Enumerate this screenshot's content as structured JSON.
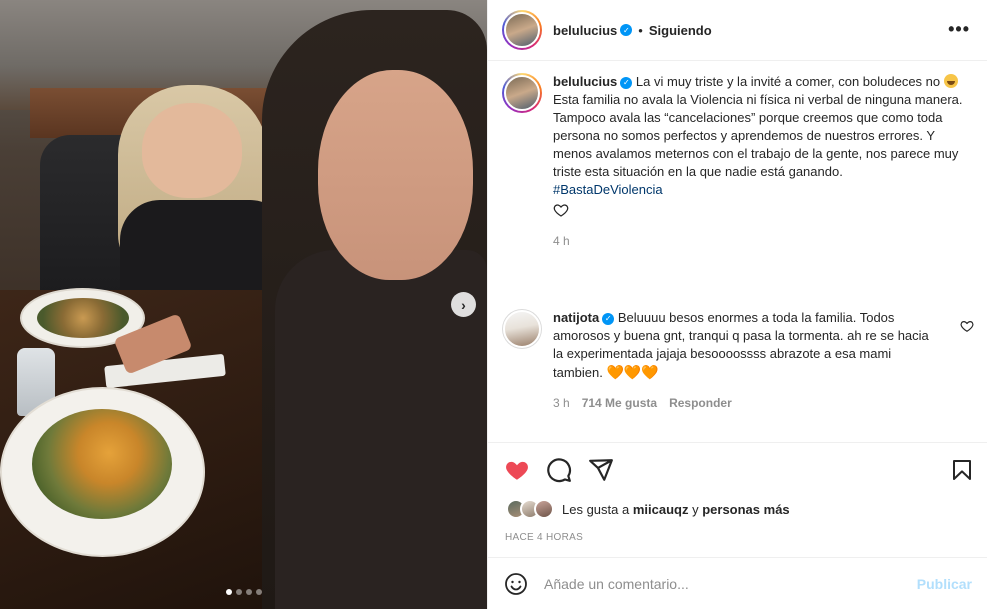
{
  "post": {
    "author": "belulucius",
    "follow_status": "Siguiendo",
    "separator": "•",
    "more_label": "•••",
    "carousel": {
      "slides": 4,
      "active_slide": 1,
      "next_label": "›"
    }
  },
  "caption": {
    "username": "belulucius",
    "text_line1": "La vi muy triste y la invité a comer, con boludeces no",
    "text_rest": "Esta familia no avala la Violencia ni física ni verbal de ninguna manera. Tampoco avala las “cancelaciones” porque creemos que como toda persona no somos perfectos y aprendemos de nuestros errores. Y menos avalamos meternos con el trabajo de la gente, nos parece muy triste esta situación en la que nadie está ganando.",
    "hashtag": "#BastaDeViolencia",
    "time": "4 h",
    "emoji": "laughing-face"
  },
  "comment": {
    "username": "natijota",
    "text": "Beluuuu besos enormes a toda la familia. Todos amorosos y buena gnt, tranqui q pasa la tormenta. ah re se hacia la experimentada jajaja besoooossss abrazote a esa mami tambien.",
    "hearts": "🧡🧡🧡",
    "time": "3 h",
    "likes": "714 Me gusta",
    "reply_label": "Responder"
  },
  "actions": {
    "liked": true,
    "like_color": "#ed4956",
    "likes_prefix": "Les gusta a",
    "liked_by": "miicauqz",
    "likes_join": "y",
    "likes_others": "personas más",
    "post_time": "HACE 4 HORAS"
  },
  "add_comment": {
    "placeholder": "Añade un comentario...",
    "publish_label": "Publicar"
  }
}
